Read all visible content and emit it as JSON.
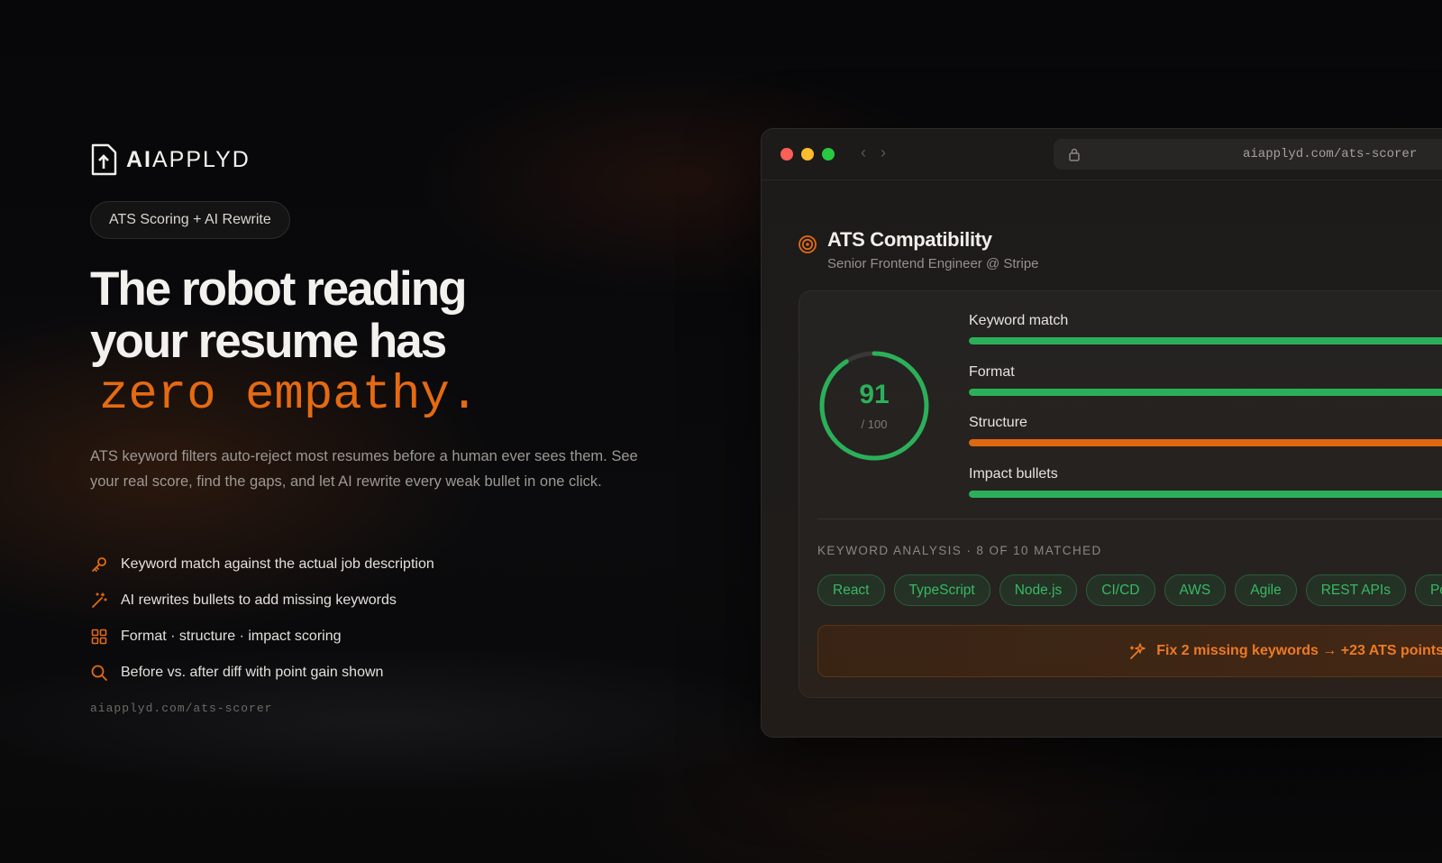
{
  "brand": {
    "logo_bold": "AI",
    "logo_rest": "APPLYD"
  },
  "hero": {
    "pill": "ATS Scoring + AI Rewrite",
    "headline_line1": "The robot reading",
    "headline_line2": "your resume has",
    "headline_accent": "zero empathy.",
    "description": "ATS keyword filters auto-reject most resumes before a human ever sees them. See your real score, find the gaps, and let AI rewrite every weak bullet in one click.",
    "features": [
      {
        "icon": "key-icon",
        "label": "Keyword match against the actual job description"
      },
      {
        "icon": "magic-wand-icon",
        "label": "AI rewrites bullets to add missing keywords"
      },
      {
        "icon": "grid-icon",
        "label": "Format · structure · impact scoring"
      },
      {
        "icon": "search-icon",
        "label": "Before vs. after diff with point gain shown"
      }
    ],
    "footer_url": "aiapplyd.com/ats-scorer"
  },
  "browser": {
    "url": "aiapplyd.com/ats-scorer",
    "card_title": "ATS Compatibility",
    "card_subtitle": "Senior Frontend Engineer @ Stripe",
    "score": "91",
    "score_out_of": "/ 100",
    "score_fraction": 0.91,
    "metrics": [
      {
        "label": "Keyword match",
        "color": "#2bb05a"
      },
      {
        "label": "Format",
        "color": "#2bb05a"
      },
      {
        "label": "Structure",
        "color": "#e0680f"
      },
      {
        "label": "Impact bullets",
        "color": "#2bb05a"
      }
    ],
    "keyword_title": "Keyword analysis · 8 of 10 matched",
    "keywords": [
      "React",
      "TypeScript",
      "Node.js",
      "CI/CD",
      "AWS",
      "Agile",
      "REST APIs",
      "Pos"
    ],
    "cta": "Fix 2 missing keywords → +23 ATS points"
  },
  "colors": {
    "accent": "#e56a12",
    "success": "#2bb05a",
    "warning": "#e0680f"
  }
}
